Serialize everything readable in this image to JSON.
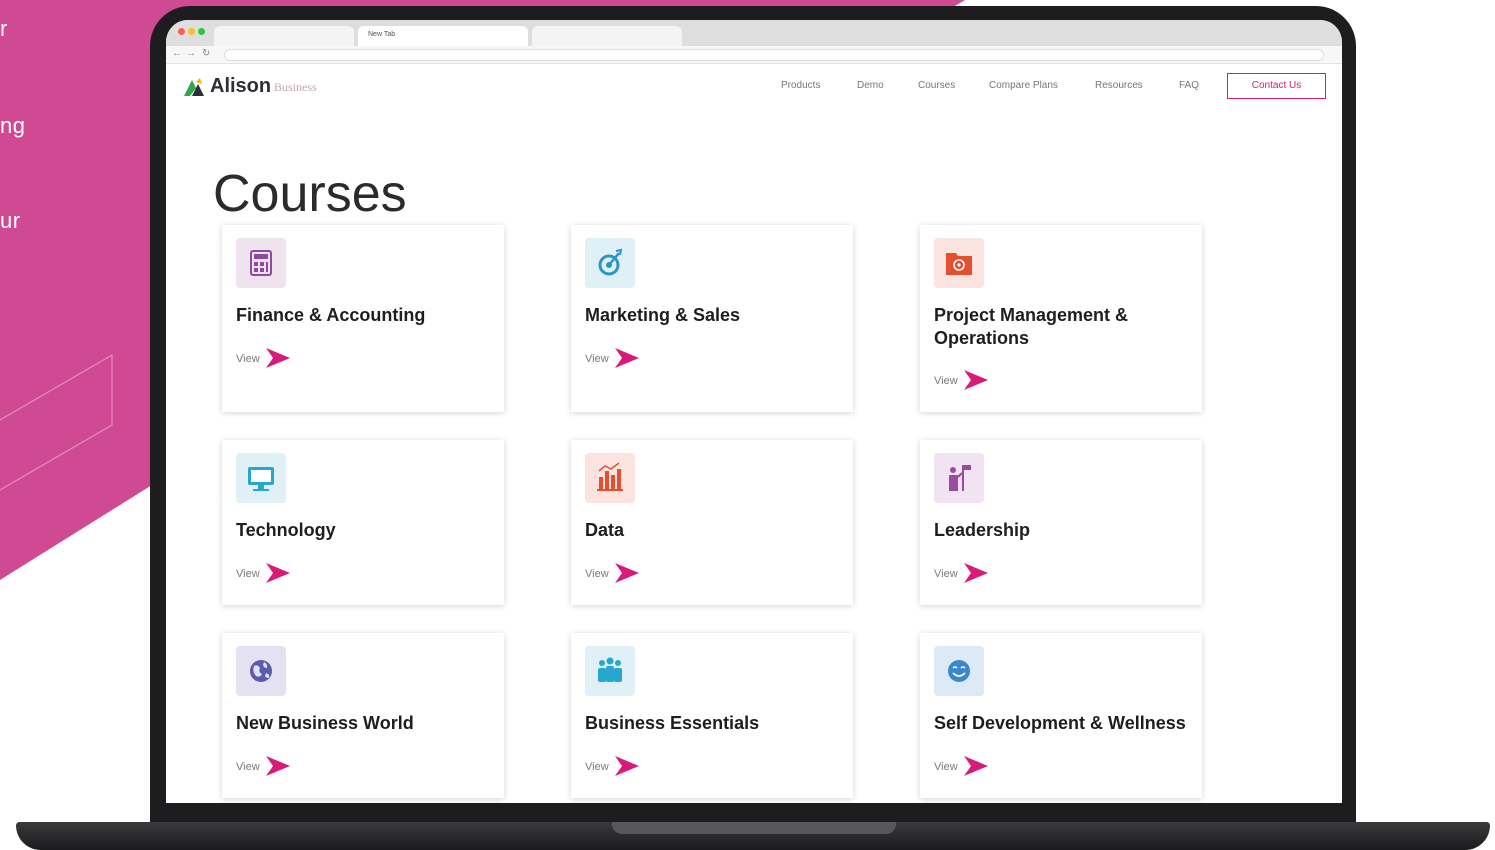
{
  "side_text": [
    "r",
    "ng",
    "ur"
  ],
  "browser": {
    "tabs": [
      "",
      "New Tab",
      ""
    ]
  },
  "nav": {
    "logo_text": "Alison",
    "logo_sub": "Business",
    "links": [
      "Products",
      "Demo",
      "Courses",
      "Compare Plans",
      "Resources",
      "FAQ"
    ],
    "contact": "Contact Us"
  },
  "page_title": "Courses",
  "courses": [
    {
      "title": "Finance & Accounting",
      "view": "View",
      "icon": "calculator-icon",
      "icon_bg": "#efe3f0",
      "icon_color": "#8e4a9c"
    },
    {
      "title": "Marketing & Sales",
      "view": "View",
      "icon": "target-icon",
      "icon_bg": "#e0f0f7",
      "icon_color": "#2b95c9"
    },
    {
      "title": "Project Management & Operations",
      "view": "View",
      "icon": "gear-folder-icon",
      "icon_bg": "#fbe4df",
      "icon_color": "#e2502f"
    },
    {
      "title": "Technology",
      "view": "View",
      "icon": "monitor-icon",
      "icon_bg": "#dff1f7",
      "icon_color": "#27a6cf"
    },
    {
      "title": "Data",
      "view": "View",
      "icon": "bar-chart-icon",
      "icon_bg": "#fbe4df",
      "icon_color": "#e2502f"
    },
    {
      "title": "Leadership",
      "view": "View",
      "icon": "leader-flag-icon",
      "icon_bg": "#f1e3f1",
      "icon_color": "#9b4aa0"
    },
    {
      "title": "New Business World",
      "view": "View",
      "icon": "globe-icon",
      "icon_bg": "#e4e2f2",
      "icon_color": "#5c5ab0"
    },
    {
      "title": "Business Essentials",
      "view": "View",
      "icon": "team-icon",
      "icon_bg": "#dff1f7",
      "icon_color": "#27a6cf"
    },
    {
      "title": "Self Development & Wellness",
      "view": "View",
      "icon": "smile-icon",
      "icon_bg": "#dce9f7",
      "icon_color": "#3a86d1"
    }
  ],
  "colors": {
    "brand": "#d81b7a",
    "pink_bg": "#cf4a93"
  }
}
